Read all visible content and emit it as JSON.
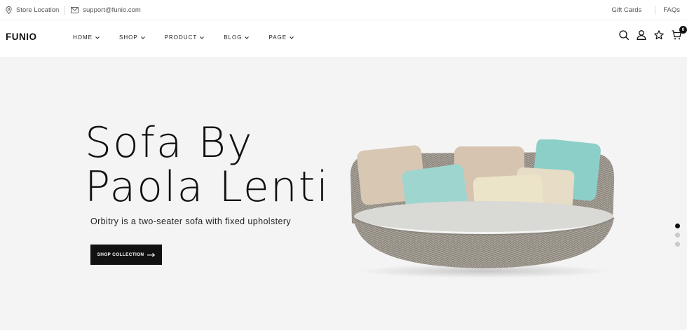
{
  "topbar": {
    "store_location": "Store Location",
    "email": "support@funio.com",
    "gift_cards": "Gift Cards",
    "faqs": "FAQs"
  },
  "header": {
    "logo": "FUNIO",
    "nav": [
      {
        "label": "HOME"
      },
      {
        "label": "SHOP"
      },
      {
        "label": "PRODUCT"
      },
      {
        "label": "BLOG"
      },
      {
        "label": "PAGE"
      }
    ],
    "cart_count": "0"
  },
  "hero": {
    "title_line1": "Sofa By",
    "title_line2": "Paola Lenti",
    "subtitle": "Orbitry is a two-seater sofa with fixed upholstery",
    "cta_label": "SHOP COLLECTION",
    "slides": {
      "count": 3,
      "active": 1
    }
  },
  "colors": {
    "accent": "#111111",
    "background": "#f4f4f4",
    "cushion_teal": "#8ccfc8",
    "cushion_beige": "#d8c7b3",
    "cushion_cream": "#ece4c9"
  }
}
